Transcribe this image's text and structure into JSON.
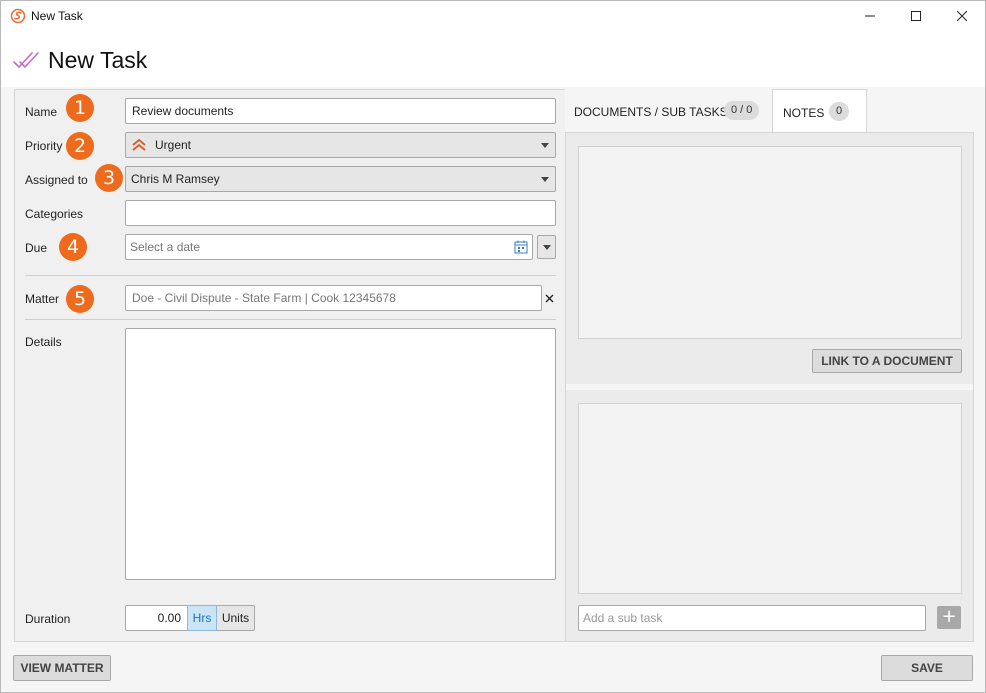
{
  "window": {
    "title": "New Task"
  },
  "header": {
    "title": "New Task"
  },
  "form": {
    "name": {
      "label": "Name",
      "badge": "1",
      "value": "Review documents"
    },
    "priority": {
      "label": "Priority",
      "badge": "2",
      "value": "Urgent"
    },
    "assigned": {
      "label": "Assigned to",
      "badge": "3",
      "value": "Chris M Ramsey"
    },
    "categories": {
      "label": "Categories",
      "value": ""
    },
    "due": {
      "label": "Due",
      "badge": "4",
      "placeholder": "Select a date"
    },
    "matter": {
      "label": "Matter",
      "badge": "5",
      "value": "Doe - Civil Dispute - State Farm | Cook 12345678"
    },
    "details": {
      "label": "Details",
      "value": ""
    },
    "duration": {
      "label": "Duration",
      "value": "0.00",
      "hrs": "Hrs",
      "units": "Units"
    }
  },
  "tabs": [
    {
      "label": "DOCUMENTS / SUB TASKS",
      "count": "0 / 0"
    },
    {
      "label": "NOTES",
      "count": "0"
    }
  ],
  "documents": {
    "link_button": "LINK TO A DOCUMENT",
    "subtask_placeholder": "Add a sub task",
    "add_button": "+"
  },
  "footer": {
    "view_matter": "VIEW MATTER",
    "save": "SAVE"
  },
  "colors": {
    "badge": "#ee6a1c",
    "priority_icon": "#d9592a",
    "header_icon": "#c56cc6",
    "hrs_active": "#cce4f7"
  }
}
